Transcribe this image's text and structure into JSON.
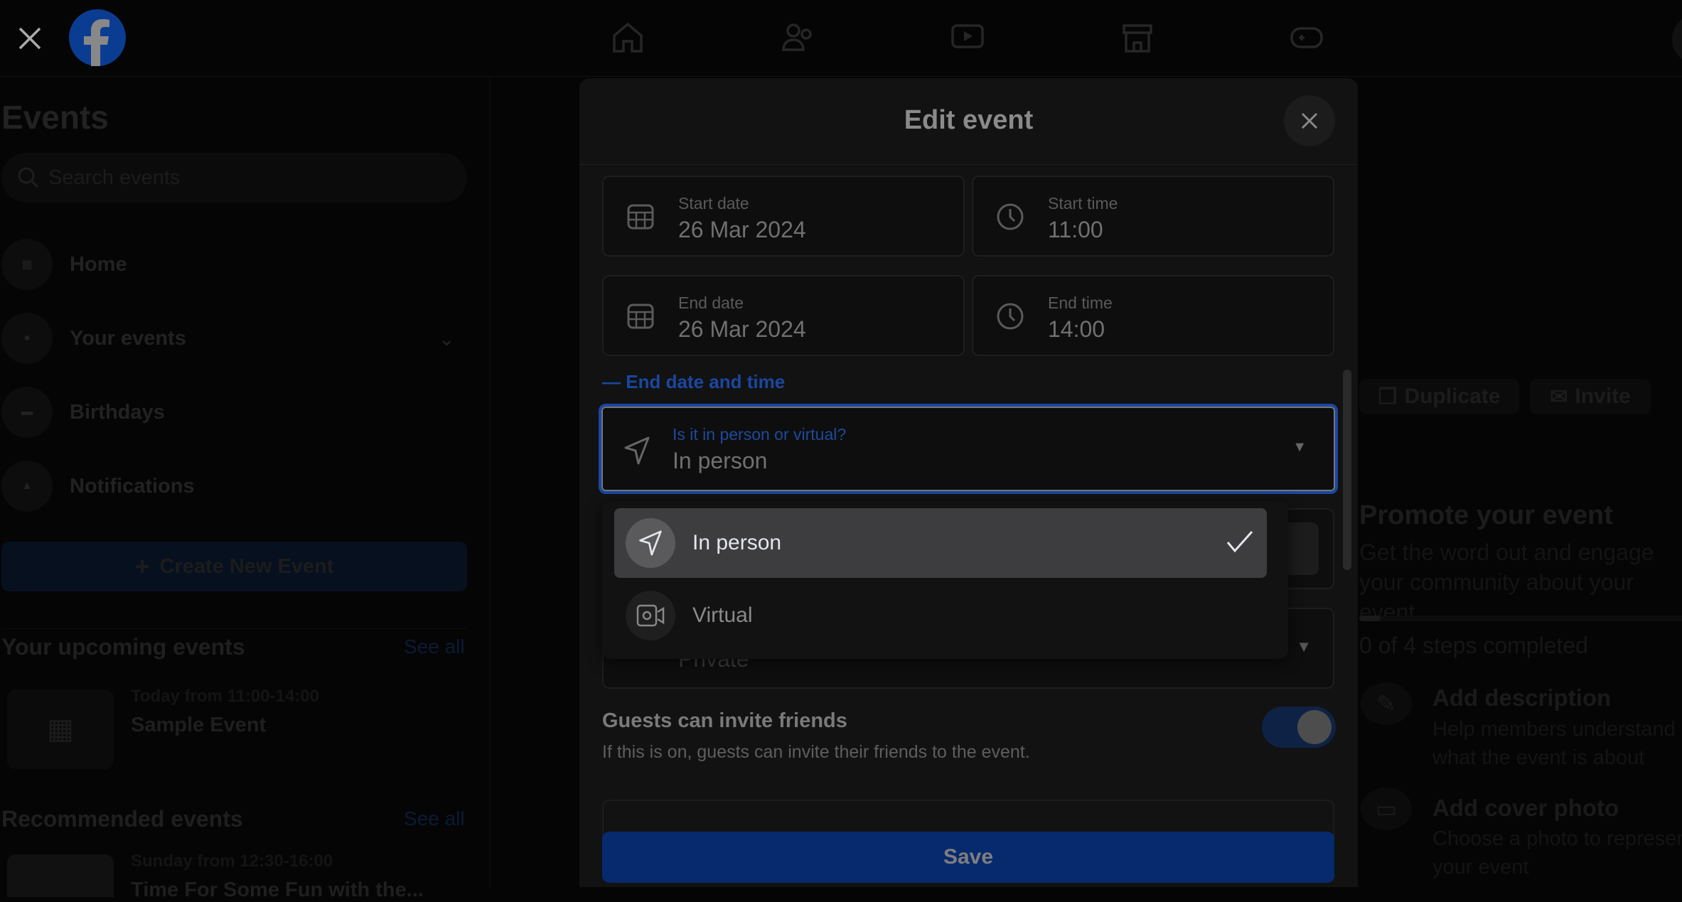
{
  "topbar": {
    "nav_icons": [
      "home-icon",
      "friends-icon",
      "video-icon",
      "marketplace-icon",
      "gaming-icon"
    ],
    "brand_color": "#0a3d91"
  },
  "sidebar": {
    "title": "Events",
    "search_placeholder": "Search events",
    "items": [
      {
        "label": "Home",
        "icon": "calendar-icon"
      },
      {
        "label": "Your events",
        "icon": "person-icon"
      },
      {
        "label": "Birthdays",
        "icon": "cake-icon"
      },
      {
        "label": "Notifications",
        "icon": "bell-icon"
      }
    ],
    "create_label": "Create New Event",
    "upcoming": {
      "title": "Your upcoming events",
      "see_all": "See all",
      "event": {
        "time": "Today from 11:00-14:00",
        "name": "Sample Event"
      }
    },
    "recommended": {
      "title": "Recommended events",
      "see_all": "See all",
      "event": {
        "time": "Sunday from 12:30-16:00",
        "name": "Time For Some Fun with the..."
      }
    }
  },
  "modal": {
    "title": "Edit event",
    "start_date": {
      "label": "Start date",
      "value": "26 Mar 2024"
    },
    "start_time": {
      "label": "Start time",
      "value": "11:00"
    },
    "end_date": {
      "label": "End date",
      "value": "26 Mar 2024"
    },
    "end_time": {
      "label": "End time",
      "value": "14:00"
    },
    "end_toggle_link": "End date and time",
    "location_type": {
      "label": "Is it in person or virtual?",
      "value": "In person"
    },
    "options": [
      {
        "label": "In person",
        "icon": "navigation-arrow-icon",
        "selected": true
      },
      {
        "label": "Virtual",
        "icon": "video-camera-icon",
        "selected": false
      }
    ],
    "privacy_value": "Private",
    "guests": {
      "title": "Guests can invite friends",
      "description": "If this is on, guests can invite their friends to the event.",
      "enabled": true
    },
    "save_label": "Save",
    "accent": "#1a56c4"
  },
  "right": {
    "duplicate": "Duplicate",
    "invite": "Invite",
    "promote_title": "Promote your event",
    "promote_desc": "Get the word out and engage your community about your event.",
    "progress": "0 of 4 steps completed",
    "progress_fraction": 0,
    "steps": [
      {
        "title": "Add description",
        "desc": "Help members understand what the event is about"
      },
      {
        "title": "Add cover photo",
        "desc": "Choose a photo to represent your event"
      }
    ]
  }
}
